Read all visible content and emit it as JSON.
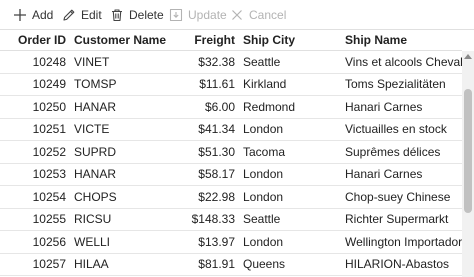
{
  "toolbar": {
    "add_label": "Add",
    "edit_label": "Edit",
    "delete_label": "Delete",
    "update_label": "Update",
    "cancel_label": "Cancel",
    "icons": [
      "plus-icon",
      "pencil-icon",
      "trash-icon",
      "save-icon",
      "close-icon"
    ]
  },
  "grid": {
    "columns": [
      "Order ID",
      "Customer Name",
      "Freight",
      "Ship City",
      "Ship Name"
    ],
    "rows": [
      {
        "order_id": "10248",
        "customer": "VINET",
        "freight": "$32.38",
        "city": "Seattle",
        "ship_name": "Vins et alcools Chevalier"
      },
      {
        "order_id": "10249",
        "customer": "TOMSP",
        "freight": "$11.61",
        "city": "Kirkland",
        "ship_name": "Toms Spezialitäten"
      },
      {
        "order_id": "10250",
        "customer": "HANAR",
        "freight": "$6.00",
        "city": "Redmond",
        "ship_name": "Hanari Carnes"
      },
      {
        "order_id": "10251",
        "customer": "VICTE",
        "freight": "$41.34",
        "city": "London",
        "ship_name": "Victuailles en stock"
      },
      {
        "order_id": "10252",
        "customer": "SUPRD",
        "freight": "$51.30",
        "city": "Tacoma",
        "ship_name": "Suprêmes délices"
      },
      {
        "order_id": "10253",
        "customer": "HANAR",
        "freight": "$58.17",
        "city": "London",
        "ship_name": "Hanari Carnes"
      },
      {
        "order_id": "10254",
        "customer": "CHOPS",
        "freight": "$22.98",
        "city": "London",
        "ship_name": "Chop-suey Chinese"
      },
      {
        "order_id": "10255",
        "customer": "RICSU",
        "freight": "$148.33",
        "city": "Seattle",
        "ship_name": "Richter Supermarkt"
      },
      {
        "order_id": "10256",
        "customer": "WELLI",
        "freight": "$13.97",
        "city": "London",
        "ship_name": "Wellington Importadora"
      },
      {
        "order_id": "10257",
        "customer": "HILAA",
        "freight": "$81.91",
        "city": "Queens",
        "ship_name": "HILARION-Abastos"
      }
    ]
  },
  "colors": {
    "toolbar_text": "#333333",
    "disabled_text": "#b3b3b3",
    "grid_line": "#e0e0e0",
    "scroll_thumb": "#c1c1c1"
  }
}
